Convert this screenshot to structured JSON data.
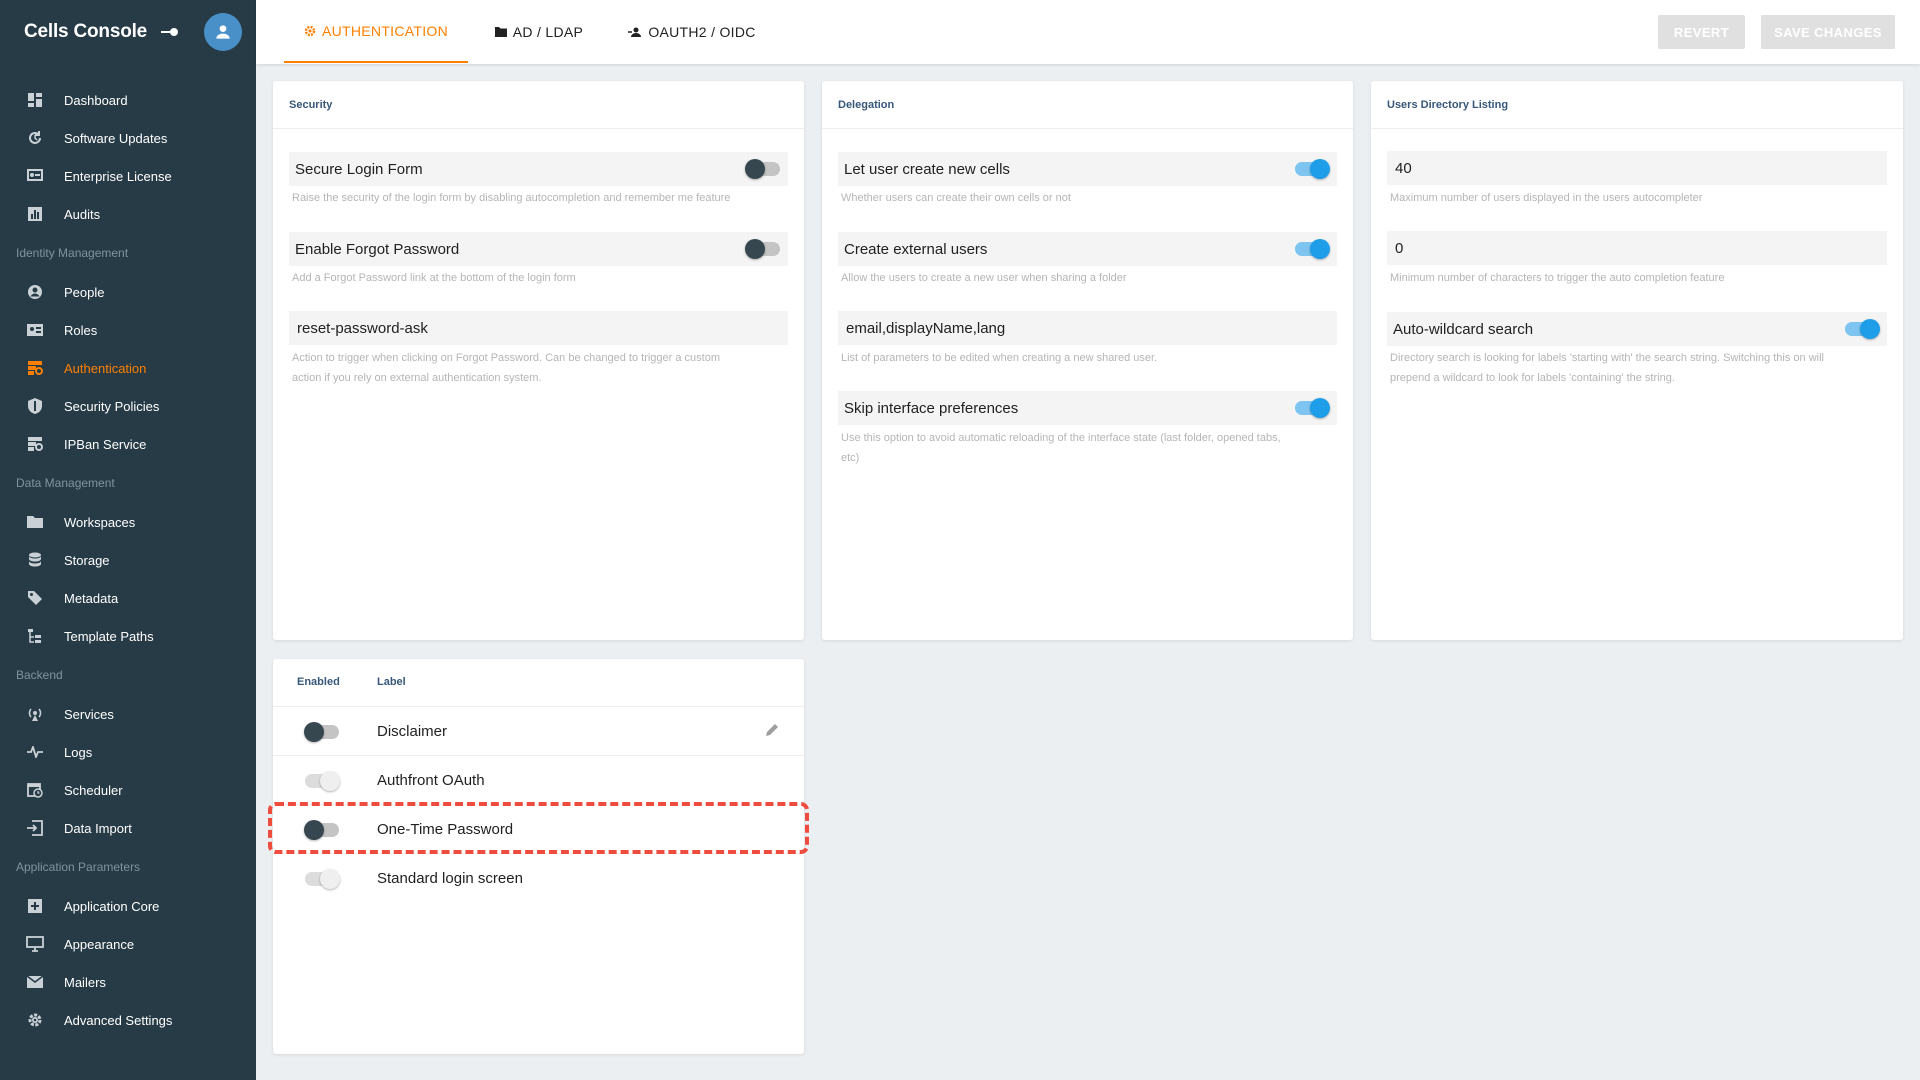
{
  "app": {
    "title": "Cells Console"
  },
  "sidebar": {
    "groups": [
      {
        "section": "",
        "items": [
          {
            "label": "Dashboard",
            "icon": "dashboard-icon"
          },
          {
            "label": "Software Updates",
            "icon": "update-icon"
          },
          {
            "label": "Enterprise License",
            "icon": "license-icon"
          },
          {
            "label": "Audits",
            "icon": "chart-icon"
          }
        ]
      },
      {
        "section": "Identity Management",
        "items": [
          {
            "label": "People",
            "icon": "person-icon"
          },
          {
            "label": "Roles",
            "icon": "id-card-icon"
          },
          {
            "label": "Authentication",
            "icon": "auth-icon",
            "active": true
          },
          {
            "label": "Security Policies",
            "icon": "shield-icon"
          },
          {
            "label": "IPBan Service",
            "icon": "ipban-icon"
          }
        ]
      },
      {
        "section": "Data Management",
        "items": [
          {
            "label": "Workspaces",
            "icon": "folder-icon"
          },
          {
            "label": "Storage",
            "icon": "database-icon"
          },
          {
            "label": "Metadata",
            "icon": "tags-icon"
          },
          {
            "label": "Template Paths",
            "icon": "file-tree-icon"
          }
        ]
      },
      {
        "section": "Backend",
        "items": [
          {
            "label": "Services",
            "icon": "broadcast-icon"
          },
          {
            "label": "Logs",
            "icon": "pulse-icon"
          },
          {
            "label": "Scheduler",
            "icon": "calendar-clock-icon"
          },
          {
            "label": "Data Import",
            "icon": "import-icon"
          }
        ]
      },
      {
        "section": "Application Parameters",
        "items": [
          {
            "label": "Application Core",
            "icon": "core-icon"
          },
          {
            "label": "Appearance",
            "icon": "monitor-icon"
          },
          {
            "label": "Mailers",
            "icon": "mail-icon"
          },
          {
            "label": "Advanced Settings",
            "icon": "gear-icon"
          }
        ]
      }
    ]
  },
  "tabs": [
    {
      "label": "AUTHENTICATION",
      "active": true
    },
    {
      "label": "AD / LDAP"
    },
    {
      "label": "OAUTH2 / OIDC"
    }
  ],
  "actions": {
    "revert": "REVERT",
    "save": "SAVE CHANGES"
  },
  "security": {
    "title": "Security",
    "secure_login": {
      "label": "Secure Login Form",
      "hint": "Raise the security of the login form by disabling autocompletion and remember me feature",
      "on": false
    },
    "forgot_password": {
      "label": "Enable Forgot Password",
      "hint": "Add a Forgot Password link at the bottom of the login form",
      "on": false
    },
    "forgot_action": {
      "value": "reset-password-ask",
      "hint1": "Action to trigger when clicking on Forgot Password. Can be changed to trigger a custom",
      "hint2": "action if you rely on external authentication system."
    }
  },
  "delegation": {
    "title": "Delegation",
    "create_cells": {
      "label": "Let user create new cells",
      "hint": "Whether users can create their own cells or not",
      "on": true
    },
    "external_users": {
      "label": "Create external users",
      "hint": "Allow the users to create a new user when sharing a folder",
      "on": true
    },
    "params": {
      "value": "email,displayName,lang",
      "hint": "List of parameters to be edited when creating a new shared user."
    },
    "skip_prefs": {
      "label": "Skip interface preferences",
      "hint1": "Use this option to avoid automatic reloading of the interface state (last folder, opened tabs,",
      "hint2": "etc)",
      "on": true
    }
  },
  "directory": {
    "title": "Users Directory Listing",
    "max_users": {
      "value": "40",
      "hint": "Maximum number of users displayed in the users autocompleter"
    },
    "min_chars": {
      "value": "0",
      "hint": "Minimum number of characters to trigger the auto completion feature"
    },
    "wildcard": {
      "label": "Auto-wildcard search",
      "hint1": "Directory search is looking for labels 'starting with' the search string. Switching this on will",
      "hint2": "prepend a wildcard to look for labels 'containing' the string.",
      "on": true
    }
  },
  "frontends": {
    "col_enabled": "Enabled",
    "col_label": "Label",
    "rows": [
      {
        "label": "Disclaimer",
        "state": "off",
        "editable": true
      },
      {
        "label": "Authfront OAuth",
        "state": "disabled"
      },
      {
        "label": "One-Time Password",
        "state": "off",
        "highlighted": true
      },
      {
        "label": "Standard login screen",
        "state": "disabled"
      }
    ]
  },
  "colors": {
    "sidebar": "#263b46",
    "accent": "#ff7f00",
    "toggle_on": "#1e9de8",
    "highlight": "#ee4c3f"
  }
}
